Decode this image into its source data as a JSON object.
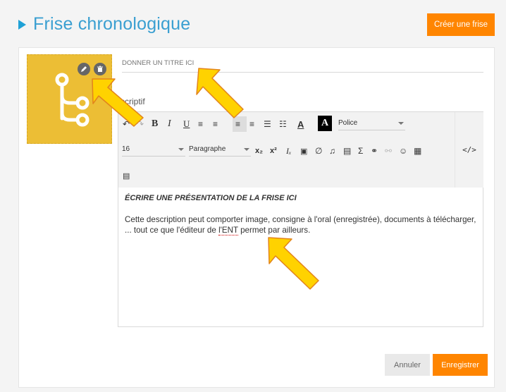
{
  "header": {
    "title": "Frise chronologique",
    "create_button": "Créer une frise"
  },
  "form": {
    "title_placeholder": "DONNER UN TITRE ICI",
    "description_label": "scriptif"
  },
  "toolbar": {
    "font_select": "Police",
    "size_select": "16",
    "format_select": "Paragraphe",
    "code_view": "</>",
    "icons": [
      "undo-icon",
      "redo-icon",
      "bold-icon",
      "italic-icon",
      "underline-icon",
      "align-justify-icon",
      "align-center-icon",
      "align-left-icon",
      "align-right-icon",
      "bullet-list-icon",
      "numbered-list-icon",
      "text-color-icon",
      "background-color-icon",
      "subscript-icon",
      "superscript-icon",
      "clear-format-icon",
      "image-icon",
      "attachment-icon",
      "audio-icon",
      "video-icon",
      "formula-icon",
      "link-icon",
      "unlink-icon",
      "emoji-icon",
      "table-icon",
      "template-icon"
    ]
  },
  "content": {
    "heading": "ÉCRIRE UNE PRÉSENTATION DE LA FRISE ICI",
    "body_before": "Cette description peut comporter image, consigne à l'oral (enregistrée), documents à télécharger, ... tout ce que l'éditeur de ",
    "body_link": "l'ENT",
    "body_after": " permet par ailleurs."
  },
  "actions": {
    "cancel": "Annuler",
    "save": "Enregistrer"
  },
  "colors": {
    "accent": "#ff8500",
    "title": "#3a9fd1",
    "thumbnail": "#ecbe35",
    "arrow": "#ffd200"
  }
}
